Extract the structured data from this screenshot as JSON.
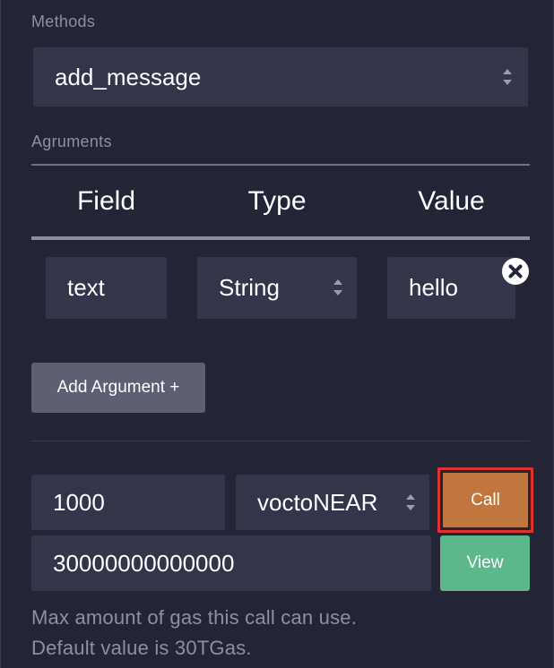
{
  "methods": {
    "label": "Methods",
    "selected": "add_message"
  },
  "arguments": {
    "label": "Agruments",
    "headers": [
      "Field",
      "Type",
      "Value"
    ],
    "row": {
      "field": "text",
      "type": "String",
      "value": "hello"
    },
    "add_label": "Add Argument +"
  },
  "call": {
    "amount": "1000",
    "unit": "voctoNEAR",
    "call_label": "Call",
    "gas": "30000000000000",
    "view_label": "View",
    "help_line1": "Max amount of gas this call can use.",
    "help_line2": "Default value is 30TGas."
  },
  "colors": {
    "call_button": "#c2763f",
    "call_highlight": "#e0342b",
    "view_button": "#5cb88a",
    "add_button": "#5d5f73"
  }
}
